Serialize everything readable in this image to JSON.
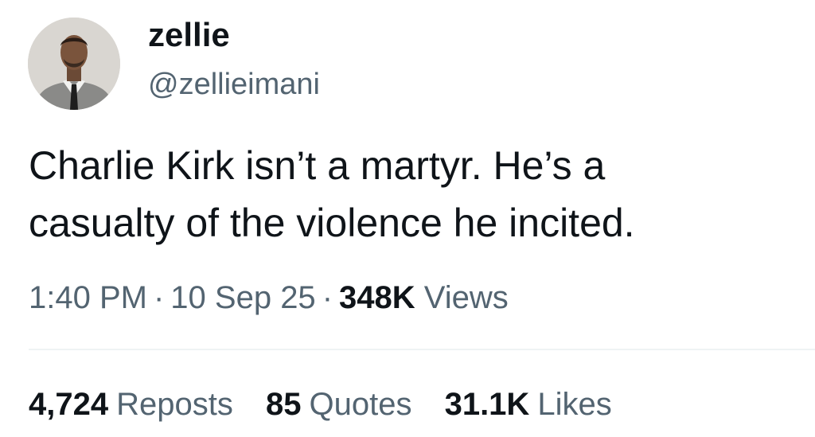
{
  "author": {
    "display_name": "zellie",
    "handle": "@zellieimani",
    "avatar_icon": "profile-photo"
  },
  "tweet": {
    "text_lines": [
      "Charlie Kirk isn’t a martyr. He’s a",
      "casualty of the violence he incited."
    ]
  },
  "meta": {
    "time": "1:40 PM",
    "separator": "·",
    "date": "10 Sep 25",
    "views_count": "348K",
    "views_label": "Views"
  },
  "stats": {
    "reposts_count": "4,724",
    "reposts_label": "Reposts",
    "quotes_count": "85",
    "quotes_label": "Quotes",
    "likes_count": "31.1K",
    "likes_label": "Likes"
  },
  "colors": {
    "text_primary": "#0f1419",
    "text_secondary": "#536471",
    "divider": "#eff3f4"
  }
}
